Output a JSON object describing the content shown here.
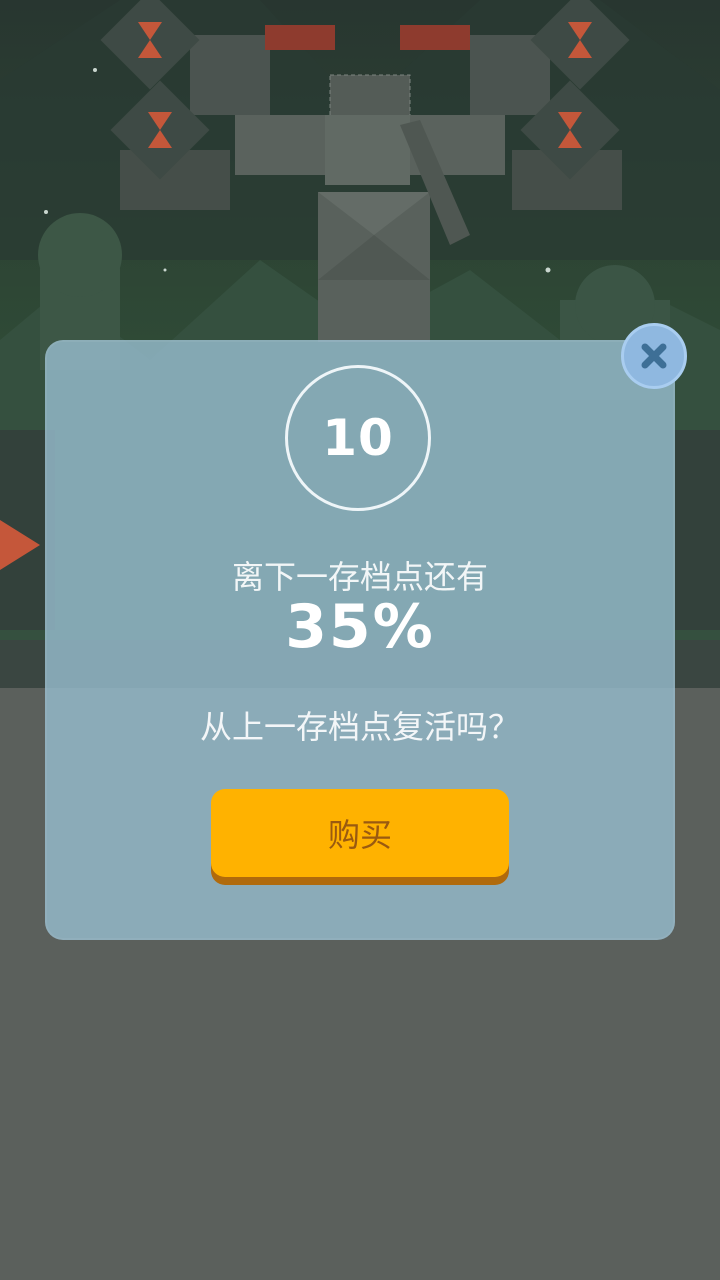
{
  "colors": {
    "modal_bg": "#96bccd",
    "buy_button": "#ffb200",
    "buy_button_shadow": "#b06a0c",
    "buy_text": "#9a5a10",
    "close_button": "#8fb8e0",
    "close_x": "#3e6f96"
  },
  "revive_dialog": {
    "score": "10",
    "checkpoint_label": "离下一存档点还有",
    "checkpoint_progress": "35%",
    "question": "从上一存档点复活吗？",
    "buy_label": "购买",
    "close_icon": "close-icon"
  }
}
